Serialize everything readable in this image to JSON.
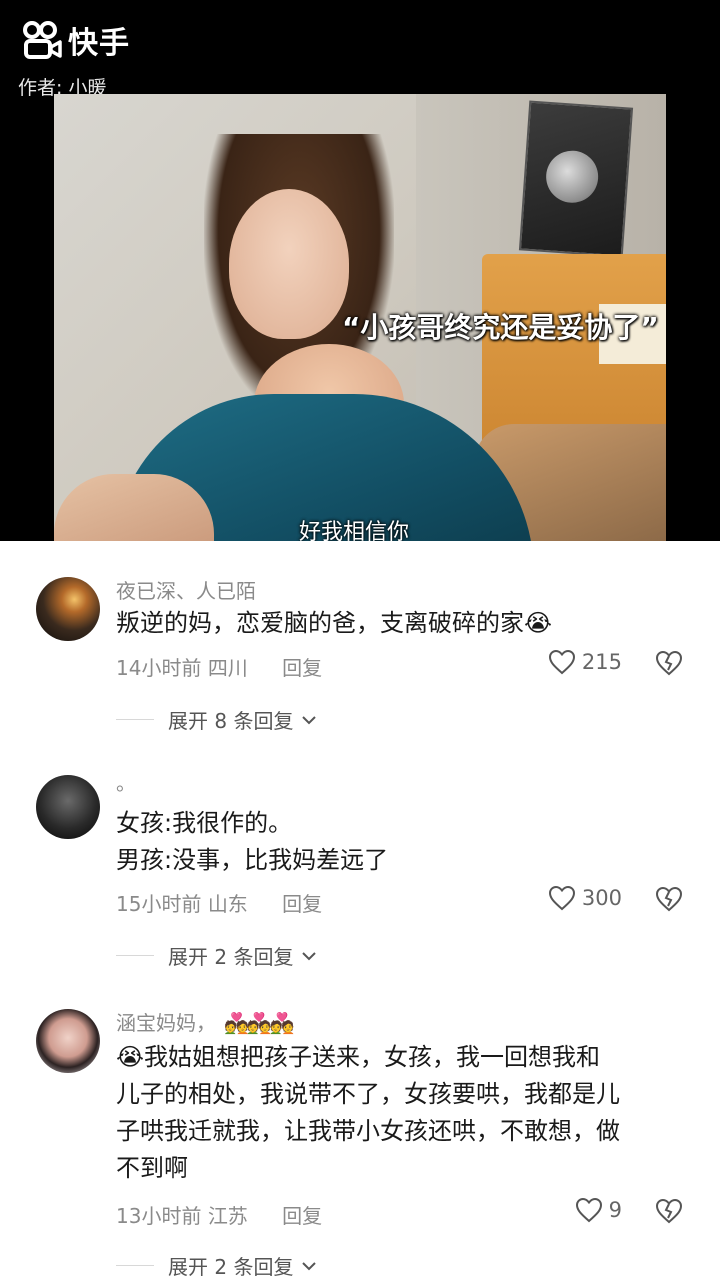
{
  "app": {
    "brand": "快手",
    "author_label": "作者: 小暖"
  },
  "video": {
    "caption": "“小孩哥终究还是妥协了”",
    "subtitle": "好我相信你"
  },
  "comments": [
    {
      "username": "夜已深、人已陌",
      "text_lines": [
        "叛逆的妈，恋爱脑的爸，支离破碎的家😭"
      ],
      "time": "14小时前",
      "location": "四川",
      "reply_label": "回复",
      "likes": "215",
      "expand_label": "展开 8 条回复"
    },
    {
      "username": "。",
      "text_lines": [
        "女孩:我很作的。",
        "男孩:没事，比我妈差远了"
      ],
      "time": "15小时前",
      "location": "山东",
      "reply_label": "回复",
      "likes": "300",
      "expand_label": "展开 2 条回复"
    },
    {
      "username": "涵宝妈妈，",
      "username_emoji": "💑💑💑",
      "text_lines": [
        "😭我姑姐想把孩子送来，女孩，我一回想我和",
        "儿子的相处，我说带不了，女孩要哄，我都是儿",
        "子哄我迁就我，让我带小女孩还哄，不敢想，做",
        "不到啊"
      ],
      "time": "13小时前",
      "location": "江苏",
      "reply_label": "回复",
      "likes": "9",
      "expand_label": "展开 2 条回复"
    }
  ],
  "icons": {
    "logo": "kuaishou-logo-icon",
    "like": "heart-outline-icon",
    "dislike": "broken-heart-icon",
    "expand": "chevron-down-icon"
  },
  "colors": {
    "header_bg": "#000000",
    "secondary_text": "#8a8a8a",
    "primary_text": "#1a1a1a"
  }
}
